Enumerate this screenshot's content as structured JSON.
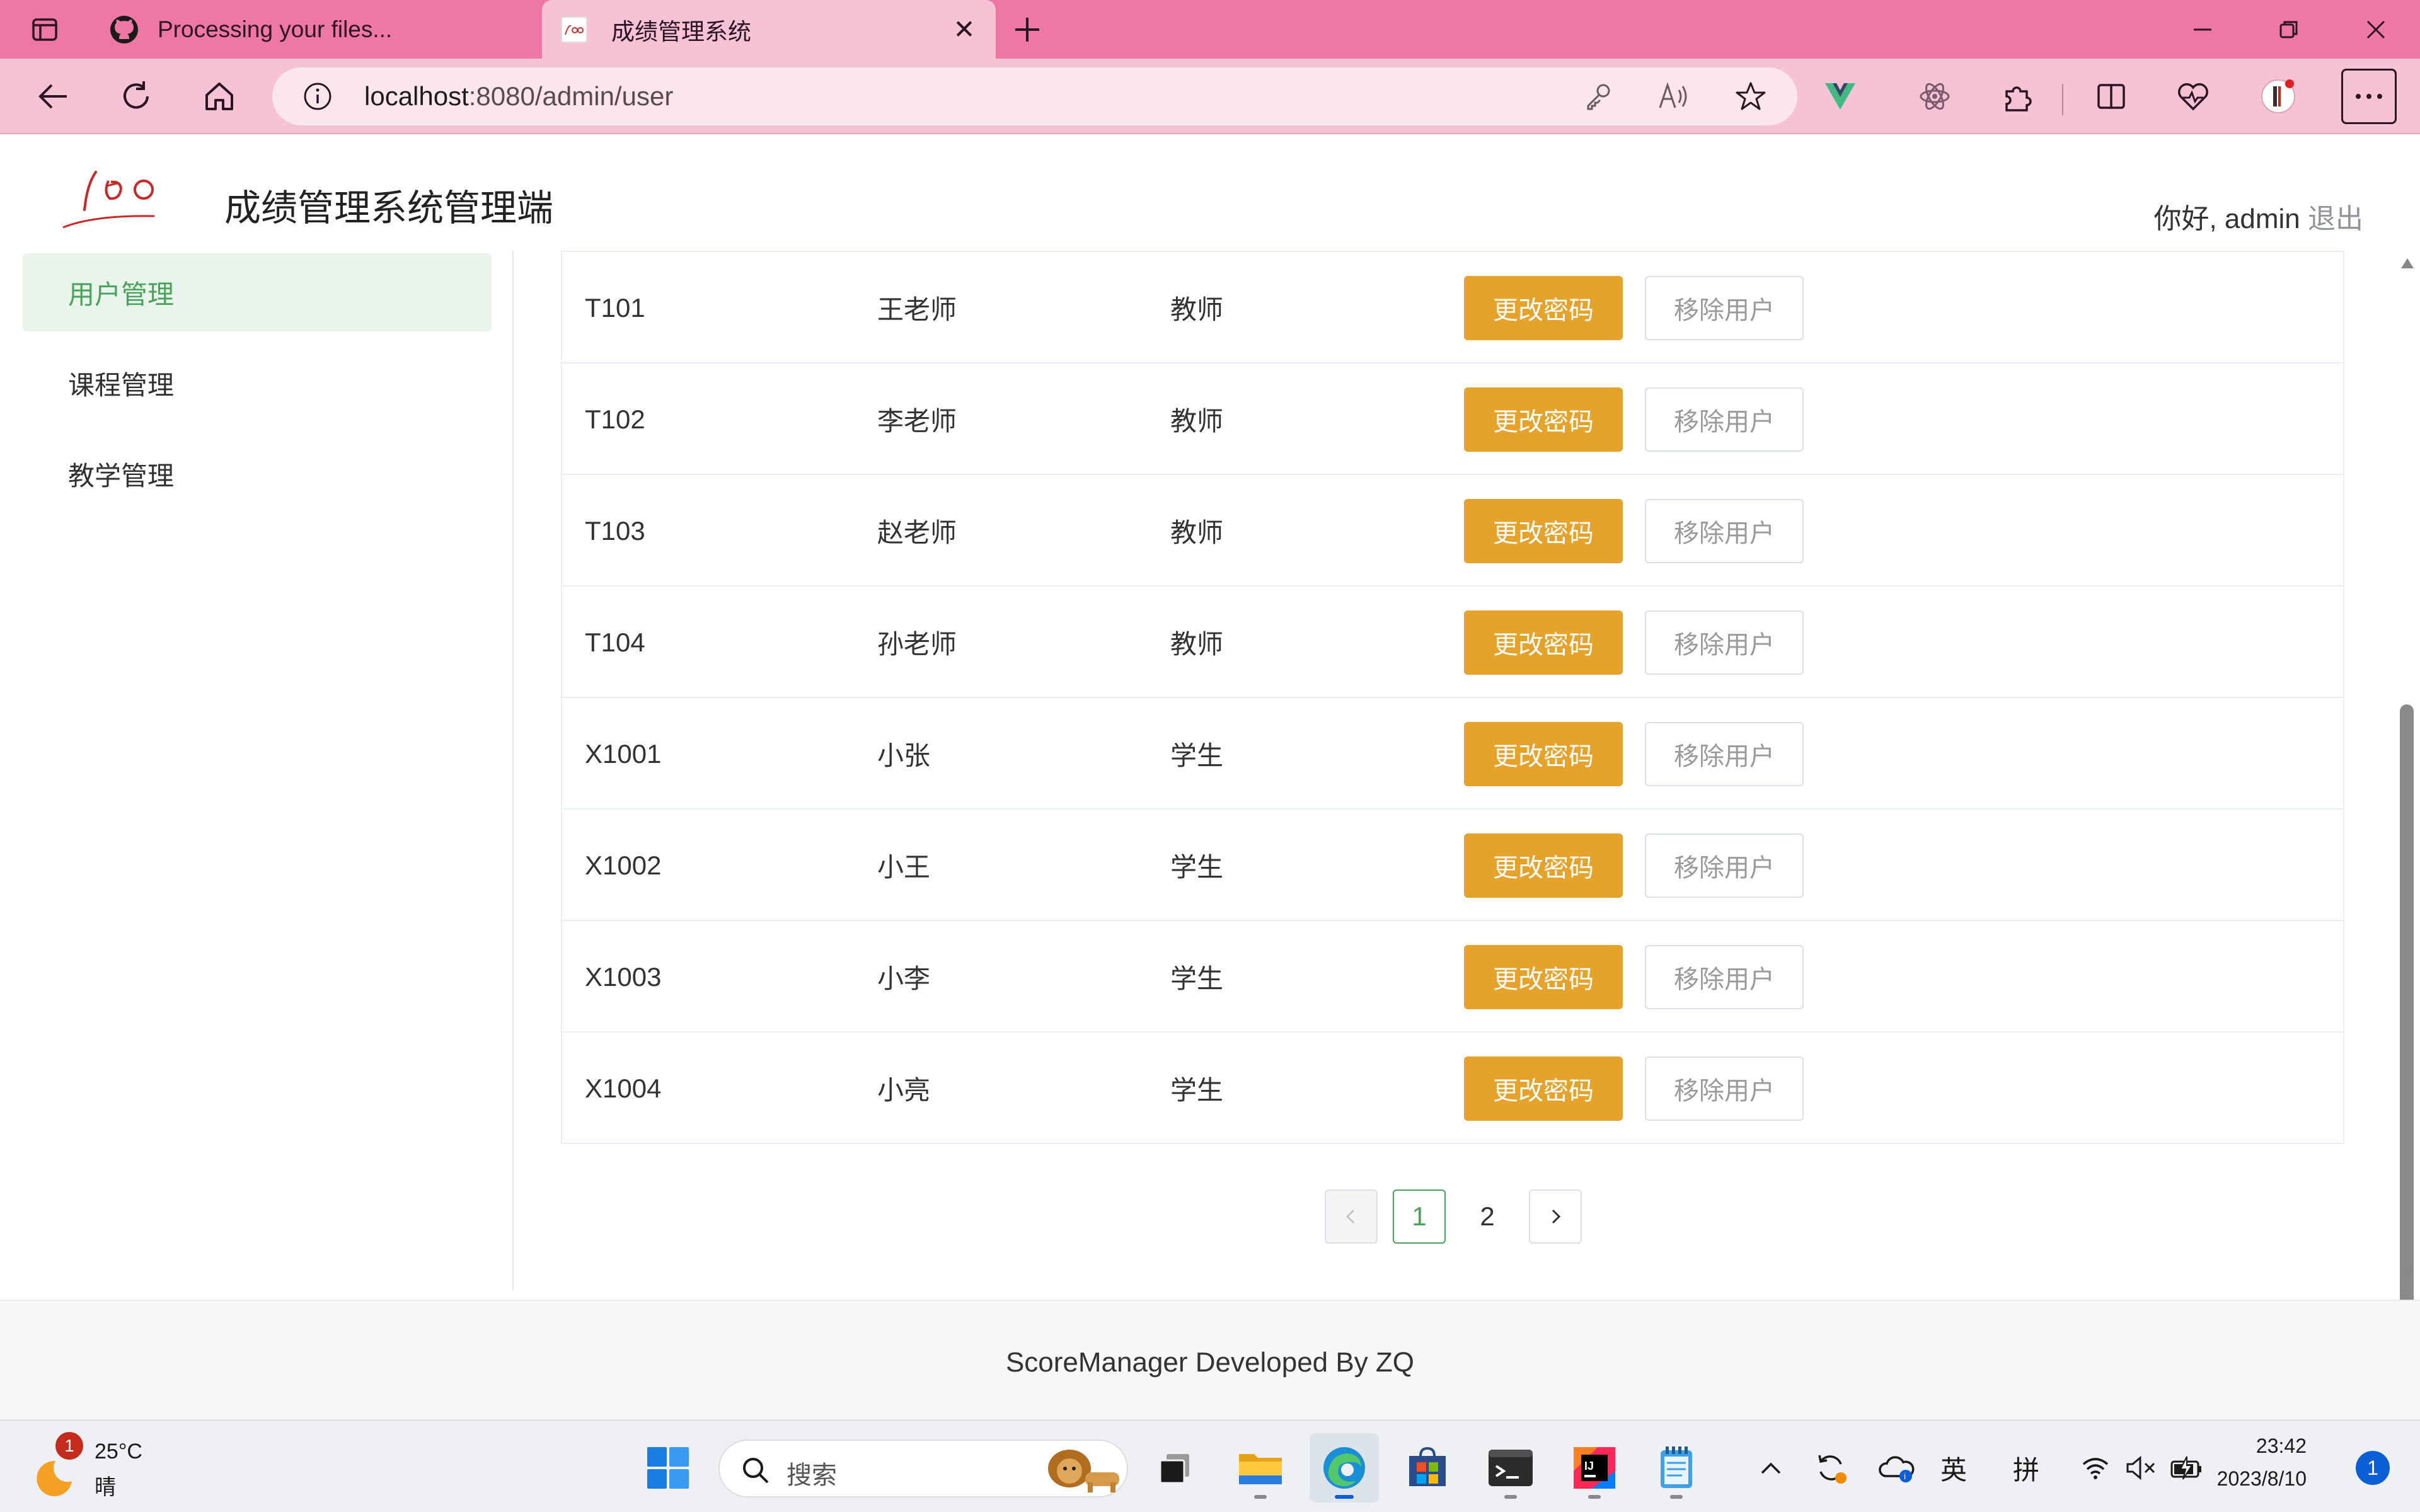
{
  "browser": {
    "tabs": [
      {
        "title": "Processing your files..."
      },
      {
        "title": "成绩管理系统"
      }
    ],
    "url_host": "localhost",
    "url_rest": ":8080/admin/user"
  },
  "header": {
    "site_title": "成绩管理系统管理端",
    "greeting": "你好, admin",
    "logout_label": "退出"
  },
  "sidebar": {
    "items": [
      {
        "label": "用户管理",
        "active": true
      },
      {
        "label": "课程管理",
        "active": false
      },
      {
        "label": "教学管理",
        "active": false
      }
    ]
  },
  "table": {
    "rows": [
      {
        "id": "T101",
        "name": "王老师",
        "role": "教师"
      },
      {
        "id": "T102",
        "name": "李老师",
        "role": "教师"
      },
      {
        "id": "T103",
        "name": "赵老师",
        "role": "教师"
      },
      {
        "id": "T104",
        "name": "孙老师",
        "role": "教师"
      },
      {
        "id": "X1001",
        "name": "小张",
        "role": "学生"
      },
      {
        "id": "X1002",
        "name": "小王",
        "role": "学生"
      },
      {
        "id": "X1003",
        "name": "小李",
        "role": "学生"
      },
      {
        "id": "X1004",
        "name": "小亮",
        "role": "学生"
      }
    ],
    "change_password_label": "更改密码",
    "remove_user_label": "移除用户"
  },
  "pagination": {
    "pages": [
      "1",
      "2"
    ],
    "current": "1"
  },
  "footer": {
    "text": "ScoreManager Developed By ZQ"
  },
  "taskbar": {
    "weather_temp": "25°C",
    "weather_cond": "晴",
    "weather_badge": "1",
    "search_placeholder": "搜索",
    "ime_lang": "英",
    "ime_mode": "拼",
    "time": "23:42",
    "date": "2023/8/10",
    "notifications": "1"
  },
  "colors": {
    "accent_green": "#4aa35a",
    "warning_orange": "#e6a32c",
    "browser_pink": "#ee78a3"
  }
}
